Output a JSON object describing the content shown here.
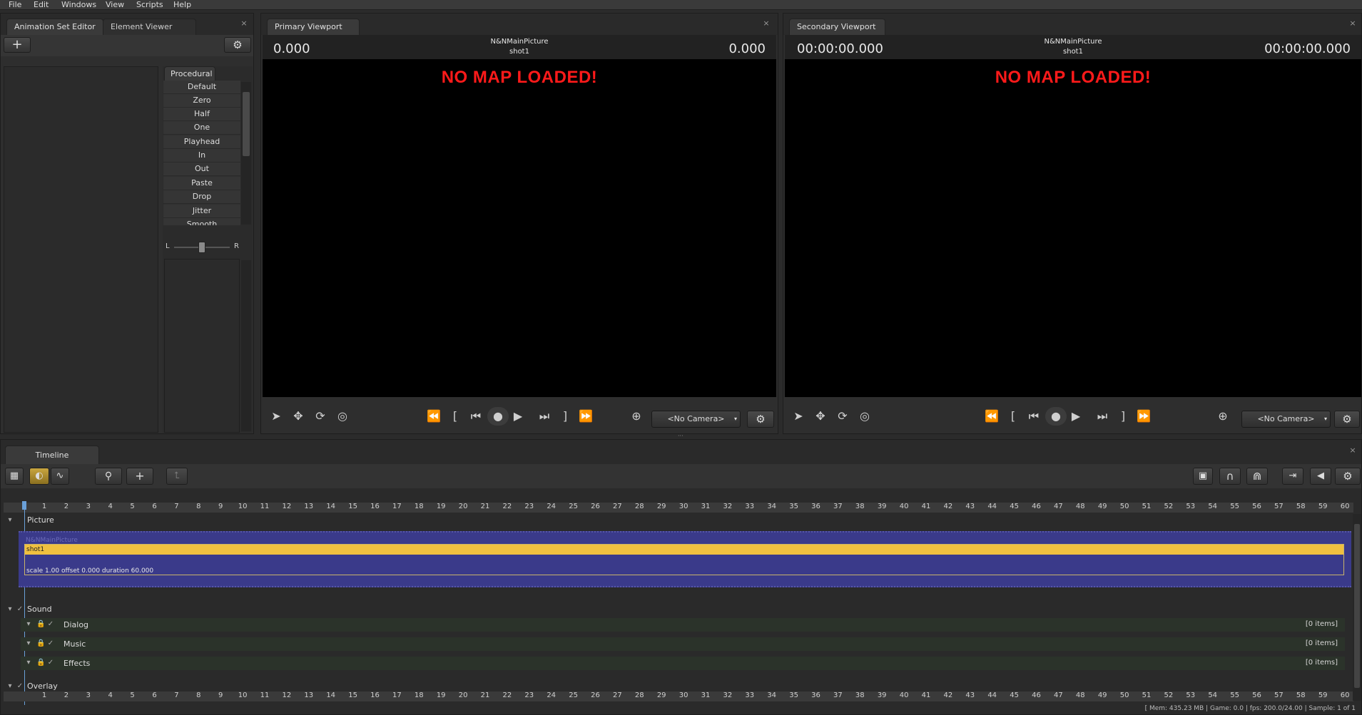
{
  "menu": [
    "File",
    "Edit",
    "Windows",
    "View",
    "Scripts",
    "Help"
  ],
  "left_panel": {
    "tabs": [
      "Animation Set Editor",
      "Element Viewer"
    ],
    "procedural_tab": "Procedural",
    "procedural_items": [
      "Default",
      "Zero",
      "Half",
      "One",
      "Playhead",
      "In",
      "Out",
      "Paste",
      "Drop",
      "Jitter",
      "Smooth"
    ],
    "slider": {
      "left": "L",
      "right": "R",
      "value": 0.5
    }
  },
  "primary": {
    "tab": "Primary Viewport",
    "title": "N&NMainPicture",
    "subtitle": "shot1",
    "time_left": "0.000",
    "time_right": "0.000",
    "message": "NO MAP LOADED!",
    "camera": "<No Camera>"
  },
  "secondary": {
    "tab": "Secondary Viewport",
    "title": "N&NMainPicture",
    "subtitle": "shot1",
    "time_left": "00:00:00.000",
    "time_right": "00:00:00.000",
    "message": "NO MAP LOADED!",
    "camera": "<No Camera>"
  },
  "timeline": {
    "tab": "Timeline",
    "ticks": [
      "1",
      "2",
      "3",
      "4",
      "5",
      "6",
      "7",
      "8",
      "9",
      "10",
      "11",
      "12",
      "13",
      "14",
      "15",
      "16",
      "17",
      "18",
      "19",
      "20",
      "21",
      "22",
      "23",
      "24",
      "25",
      "26",
      "27",
      "28",
      "29",
      "30",
      "31",
      "32",
      "33",
      "34",
      "35",
      "36",
      "37",
      "38",
      "39",
      "40",
      "41",
      "42",
      "43",
      "44",
      "45",
      "46",
      "47",
      "48",
      "49",
      "50",
      "51",
      "52",
      "53",
      "54",
      "55",
      "56",
      "57",
      "58",
      "59",
      "60"
    ],
    "picture_label": "Picture",
    "clip_name": "N&NMainPicture",
    "shot_label": "shot1",
    "shot_info": "scale 1.00 offset 0.000 duration 60.000",
    "sound_label": "Sound",
    "sound_tracks": [
      {
        "name": "Dialog",
        "count": "[0 items]"
      },
      {
        "name": "Music",
        "count": "[0 items]"
      },
      {
        "name": "Effects",
        "count": "[0 items]"
      }
    ],
    "overlay_label": "Overlay"
  },
  "status": "[ Mem: 435.23 MB | Game: 0.0 | fps: 200.0/24.00 | Sample: 1 of 1",
  "colors": {
    "clip_bg": "#3a3a8a",
    "shot_bar": "#f0c040",
    "no_map": "#ff1a1a",
    "sound_row": "#2b332a"
  }
}
